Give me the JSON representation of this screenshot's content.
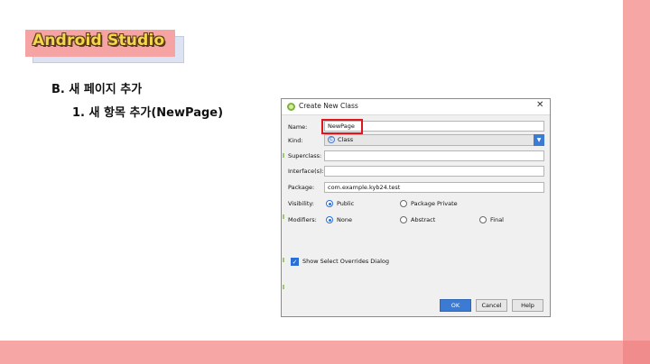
{
  "slide": {
    "title": "Android Studio",
    "section_heading": "B. 새 페이지 추가",
    "sub_heading": "1.  새 항목 추가(NewPage)"
  },
  "dialog": {
    "title": "Create New Class",
    "close_glyph": "✕",
    "name_label": "Name:",
    "name_value": "NewPage",
    "kind_label": "Kind:",
    "kind_value": "Class",
    "kind_icon_glyph": "C",
    "dropdown_glyph": "▼",
    "superclass_label": "Superclass:",
    "superclass_value": "",
    "interfaces_label": "Interface(s):",
    "interfaces_value": "",
    "package_label": "Package:",
    "package_value": "com.example.kyb24.test",
    "visibility_label": "Visibility:",
    "visibility_options": [
      "Public",
      "Package Private"
    ],
    "visibility_selected": "Public",
    "modifiers_label": "Modifiers:",
    "modifier_options": [
      "None",
      "Abstract",
      "Final"
    ],
    "modifier_selected": "None",
    "overrides_label": "Show Select Overrides Dialog",
    "overrides_checked": true,
    "check_glyph": "✓",
    "ok_label": "OK",
    "cancel_label": "Cancel",
    "help_label": "Help"
  },
  "colors": {
    "accent_band": "#f7a6a6",
    "highlight_box": "#e0161e",
    "primary_button": "#3b7bd4",
    "title_text": "#f4d74a"
  }
}
